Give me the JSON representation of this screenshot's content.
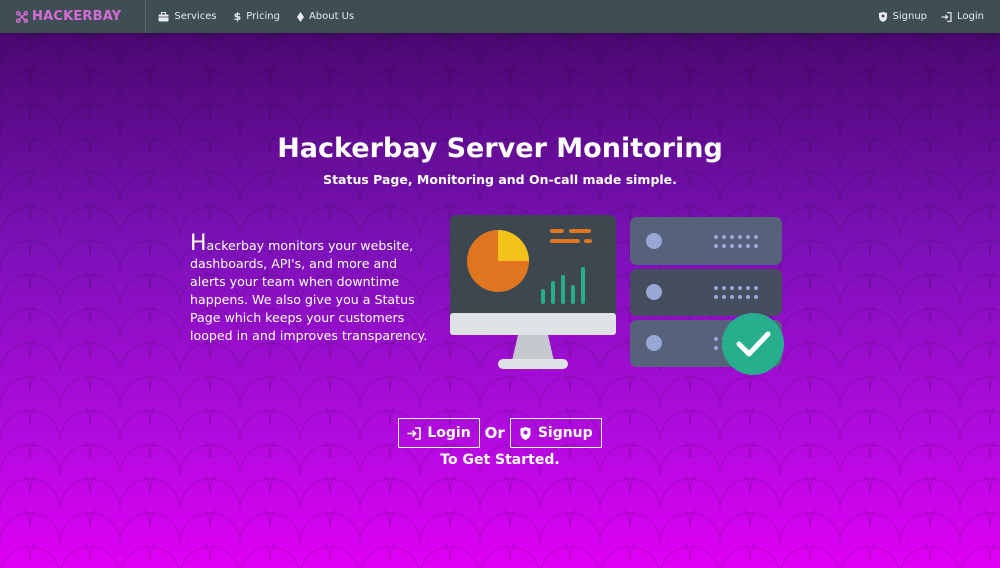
{
  "nav": {
    "brand": "HACKERBAY",
    "brand_icon": "drone-icon",
    "items": [
      {
        "label": "Services",
        "icon": "briefcase-icon"
      },
      {
        "label": "Pricing",
        "icon": "dollar-icon"
      },
      {
        "label": "About Us",
        "icon": "diamond-icon"
      }
    ],
    "signup": "Signup",
    "login": "Login"
  },
  "hero": {
    "title": "Hackerbay Server Monitoring",
    "subtitle": "Status Page, Monitoring and On-call made simple.",
    "description_initial": "H",
    "description_rest": "ackerbay monitors your website, dashboards, API's, and more and alerts your team when downtime happens. We also give you a Status Page which keeps your customers looped in and improves transparency.",
    "cta_login": "Login",
    "cta_or": "Or",
    "cta_signup": "Signup",
    "cta_footer": "To Get Started."
  },
  "colors": {
    "navbar": "#3f4d55",
    "brand": "#d66bd8",
    "gradient_top": "#4a0870",
    "gradient_bottom": "#e000f4",
    "check_green": "#27ae8c"
  }
}
